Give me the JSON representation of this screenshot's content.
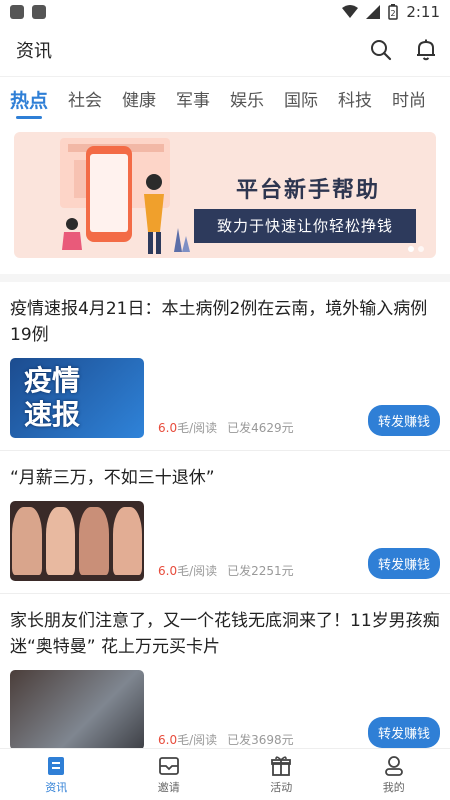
{
  "status": {
    "time": "2:11",
    "battery_level": "2"
  },
  "appbar": {
    "title": "资讯"
  },
  "tabs": [
    {
      "label": "热点",
      "active": true
    },
    {
      "label": "社会"
    },
    {
      "label": "健康"
    },
    {
      "label": "军事"
    },
    {
      "label": "娱乐"
    },
    {
      "label": "国际"
    },
    {
      "label": "科技"
    },
    {
      "label": "时尚"
    }
  ],
  "banner": {
    "headline": "平台新手帮助",
    "subline": "致力于快速让你轻松挣钱"
  },
  "news": [
    {
      "title": "疫情速报4月21日：本土病例2例在云南，境外输入病例19例",
      "thumb_text": [
        "疫情",
        "速报"
      ],
      "price": "6.0",
      "price_unit": "毛/阅读",
      "sent": "已发4629元",
      "button": "转发赚钱"
    },
    {
      "title": "“月薪三万，不如三十退休”",
      "price": "6.0",
      "price_unit": "毛/阅读",
      "sent": "已发2251元",
      "button": "转发赚钱"
    },
    {
      "title": "家长朋友们注意了，又一个花钱无底洞来了！11岁男孩痴迷“奥特曼” 花上万元买卡片",
      "price": "6.0",
      "price_unit": "毛/阅读",
      "sent": "已发3698元",
      "button": "转发赚钱"
    }
  ],
  "bottom_nav": [
    {
      "label": "资讯",
      "icon": "news-icon",
      "active": true
    },
    {
      "label": "邀请",
      "icon": "invite-icon"
    },
    {
      "label": "活动",
      "icon": "gift-icon"
    },
    {
      "label": "我的",
      "icon": "profile-icon"
    }
  ],
  "colors": {
    "accent": "#2f7fd6",
    "price": "#e74c3c",
    "banner_bg": "#fbe4dc"
  }
}
